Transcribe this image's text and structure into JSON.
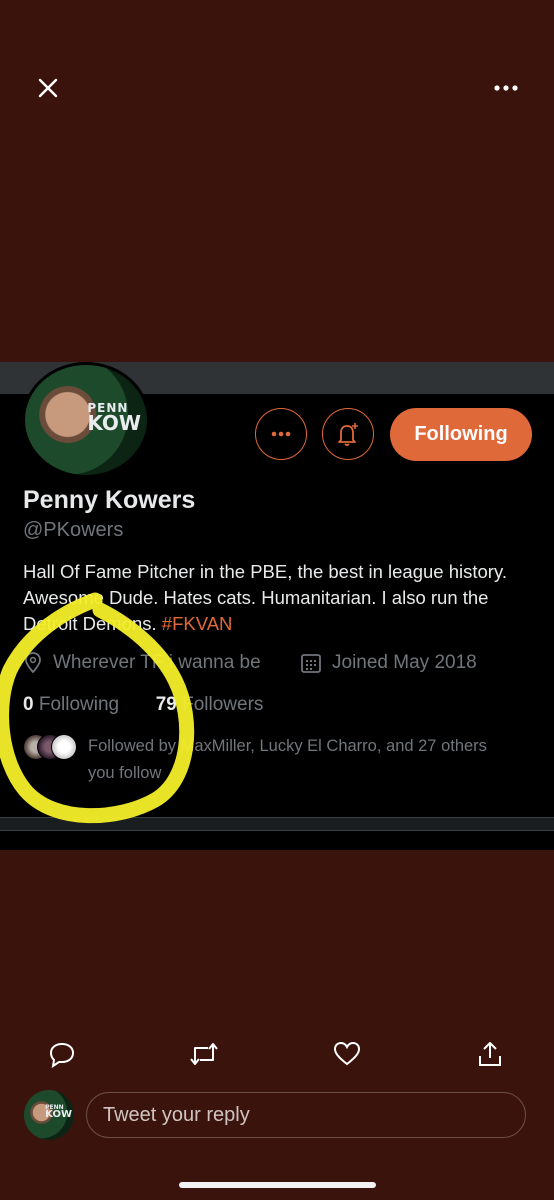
{
  "profile": {
    "avatar_text_line1": "PENN",
    "avatar_text_line2": "KOW",
    "name": "Penny Kowers",
    "handle": "@PKowers",
    "bio_text": "Hall Of Fame Pitcher in the PBE, the best in league history. Awesome Dude. Hates cats. Humanitarian. I also run the Detroit Demons. ",
    "bio_hashtag": "#FKVAN",
    "location": "Wherever TF i wanna be",
    "joined": "Joined May 2018",
    "following_count": "0",
    "following_label": "Following",
    "followers_count": "79",
    "followers_label": "Followers",
    "followed_by": "Followed by MaxMiller, Lucky El Charro, and 27 others you follow"
  },
  "buttons": {
    "follow_label": "Following"
  },
  "reply": {
    "placeholder": "Tweet your reply"
  },
  "icons": {
    "close": "close-icon",
    "more": "more-icon",
    "notifications": "bell-plus-icon",
    "location": "location-pin-icon",
    "calendar": "calendar-icon",
    "reply": "reply-icon",
    "retweet": "retweet-icon",
    "like": "heart-icon",
    "share": "share-icon"
  },
  "colors": {
    "background": "#3a130d",
    "card": "#000000",
    "accent": "#e0693a",
    "annotation": "#f5ef29"
  }
}
